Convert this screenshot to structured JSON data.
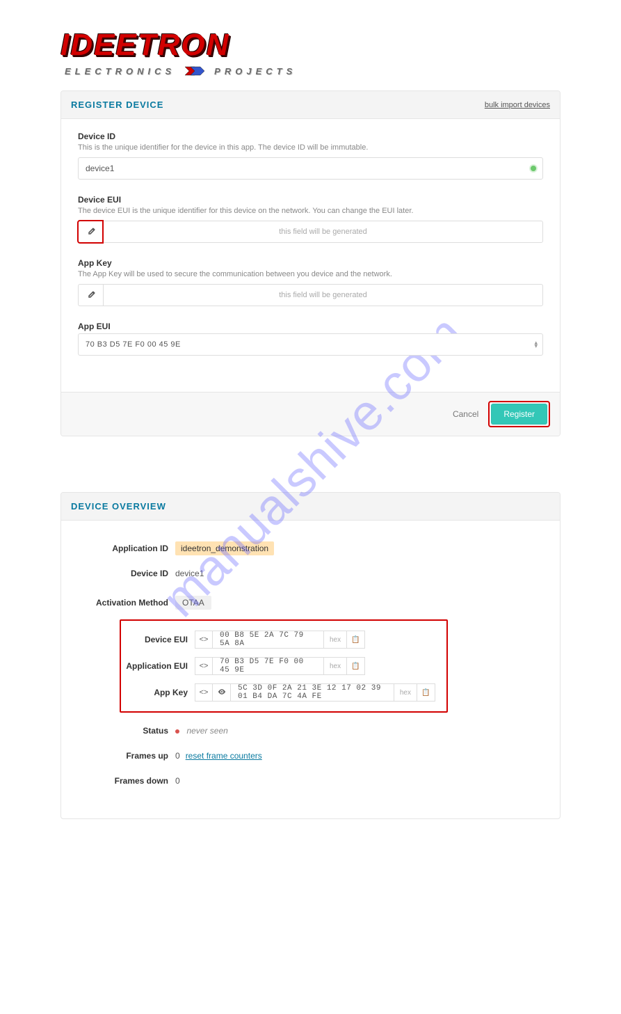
{
  "logo": {
    "name": "IDEETRON",
    "sub_left": "ELECTRONICS",
    "sub_right": "PROJECTS"
  },
  "watermark": "manualshive.com",
  "register": {
    "title": "REGISTER DEVICE",
    "bulk_link": "bulk import devices",
    "device_id": {
      "label": "Device ID",
      "hint": "This is the unique identifier for the device in this app. The device ID will be immutable.",
      "value": "device1"
    },
    "device_eui": {
      "label": "Device EUI",
      "hint": "The device EUI is the unique identifier for this device on the network. You can change the EUI later.",
      "placeholder": "this field will be generated"
    },
    "app_key": {
      "label": "App Key",
      "hint": "The App Key will be used to secure the communication between you device and the network.",
      "placeholder": "this field will be generated"
    },
    "app_eui": {
      "label": "App EUI",
      "value": "70 B3 D5 7E F0 00 45 9E"
    },
    "cancel_label": "Cancel",
    "register_label": "Register"
  },
  "overview": {
    "title": "DEVICE OVERVIEW",
    "labels": {
      "application_id": "Application ID",
      "device_id": "Device ID",
      "activation_method": "Activation Method",
      "device_eui": "Device EUI",
      "application_eui": "Application EUI",
      "app_key": "App Key",
      "status": "Status",
      "frames_up": "Frames up",
      "frames_down": "Frames down"
    },
    "hex_label": "hex",
    "values": {
      "application_id": "ideetron_demonstration",
      "device_id": "device1",
      "activation_method": "OTAA",
      "device_eui": "00 B8 5E 2A 7C 79 5A 8A",
      "application_eui": "70 B3 D5 7E F0 00 45 9E",
      "app_key": "5C 3D 0F 2A 21 3E 12 17 02 39 01 B4 DA 7C 4A FE",
      "status": "never seen",
      "frames_up": "0",
      "frames_down": "0",
      "reset_link": "reset frame counters"
    }
  }
}
